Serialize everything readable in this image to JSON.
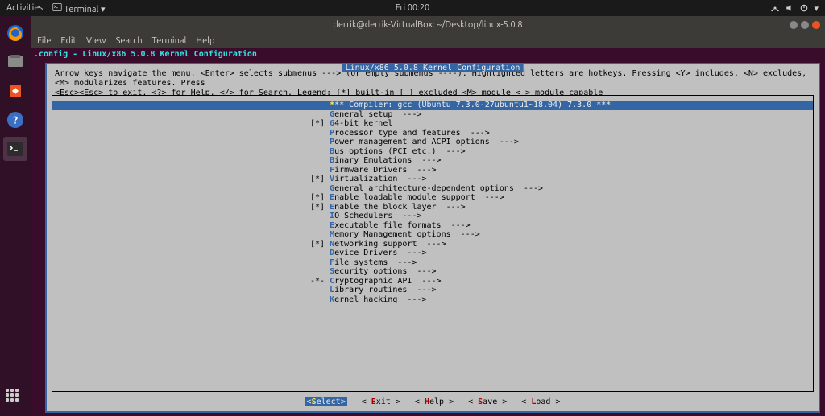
{
  "topbar": {
    "activities": "Activities",
    "app": "Terminal",
    "clock": "Fri 00:20"
  },
  "window": {
    "title": "derrik@derrik-VirtualBox: ~/Desktop/linux-5.0.8",
    "menu": [
      "File",
      "Edit",
      "View",
      "Search",
      "Terminal",
      "Help"
    ]
  },
  "prompt": ".config - Linux/x86 5.0.8 Kernel Configuration",
  "menuconfig": {
    "title": "Linux/x86 5.0.8 Kernel Configuration",
    "instructions_line1": "Arrow keys navigate the menu.  <Enter> selects submenus ---> (or empty submenus ----).  Highlighted letters are hotkeys.  Pressing <Y> includes, <N> excludes, <M> modularizes features.  Press",
    "instructions_line2": "<Esc><Esc> to exit, <?> for Help, </> for Search.  Legend: [*] built-in  [ ] excluded  <M> module  < > module capable",
    "items": [
      {
        "prefix": "    ",
        "hk": "*",
        "text": "** Compiler: gcc (Ubuntu 7.3.0-27ubuntu1~18.04) 7.3.0 ***",
        "selected": true
      },
      {
        "prefix": "    ",
        "hk": "G",
        "text": "eneral setup  --->"
      },
      {
        "prefix": "[*] ",
        "hk": "6",
        "text": "4-bit kernel"
      },
      {
        "prefix": "    ",
        "hk": "P",
        "text": "rocessor type and features  --->"
      },
      {
        "prefix": "    ",
        "hk": "P",
        "text": "ower management and ACPI options  --->"
      },
      {
        "prefix": "    ",
        "hk": "B",
        "text": "us options (PCI etc.)  --->"
      },
      {
        "prefix": "    ",
        "hk": "B",
        "text": "inary Emulations  --->"
      },
      {
        "prefix": "    ",
        "hk": "F",
        "text": "irmware Drivers  --->"
      },
      {
        "prefix": "[*] ",
        "hk": "V",
        "text": "irtualization  --->"
      },
      {
        "prefix": "    ",
        "hk": "G",
        "text": "eneral architecture-dependent options  --->"
      },
      {
        "prefix": "[*] ",
        "hk": "E",
        "text": "nable loadable module support  --->"
      },
      {
        "prefix": "[*] ",
        "hk": "E",
        "text": "nable the block layer  --->"
      },
      {
        "prefix": "    ",
        "hk": "I",
        "text": "O Schedulers  --->"
      },
      {
        "prefix": "    ",
        "hk": "E",
        "text": "xecutable file formats  --->"
      },
      {
        "prefix": "    ",
        "hk": "M",
        "text": "emory Management options  --->"
      },
      {
        "prefix": "[*] ",
        "hk": "N",
        "text": "etworking support  --->"
      },
      {
        "prefix": "    ",
        "hk": "D",
        "text": "evice Drivers  --->"
      },
      {
        "prefix": "    ",
        "hk": "F",
        "text": "ile systems  --->"
      },
      {
        "prefix": "    ",
        "hk": "S",
        "text": "ecurity options  --->"
      },
      {
        "prefix": "-*- ",
        "hk": "C",
        "text": "ryptographic API  --->"
      },
      {
        "prefix": "    ",
        "hk": "L",
        "text": "ibrary routines  --->"
      },
      {
        "prefix": "    ",
        "hk": "K",
        "text": "ernel hacking  --->"
      }
    ],
    "footer": [
      {
        "pre": "<",
        "hk": "S",
        "post": "elect>",
        "selected": true
      },
      {
        "pre": "< ",
        "hk": "E",
        "post": "xit >"
      },
      {
        "pre": "< ",
        "hk": "H",
        "post": "elp >"
      },
      {
        "pre": "< ",
        "hk": "S",
        "post": "ave >"
      },
      {
        "pre": "< ",
        "hk": "L",
        "post": "oad >"
      }
    ]
  }
}
